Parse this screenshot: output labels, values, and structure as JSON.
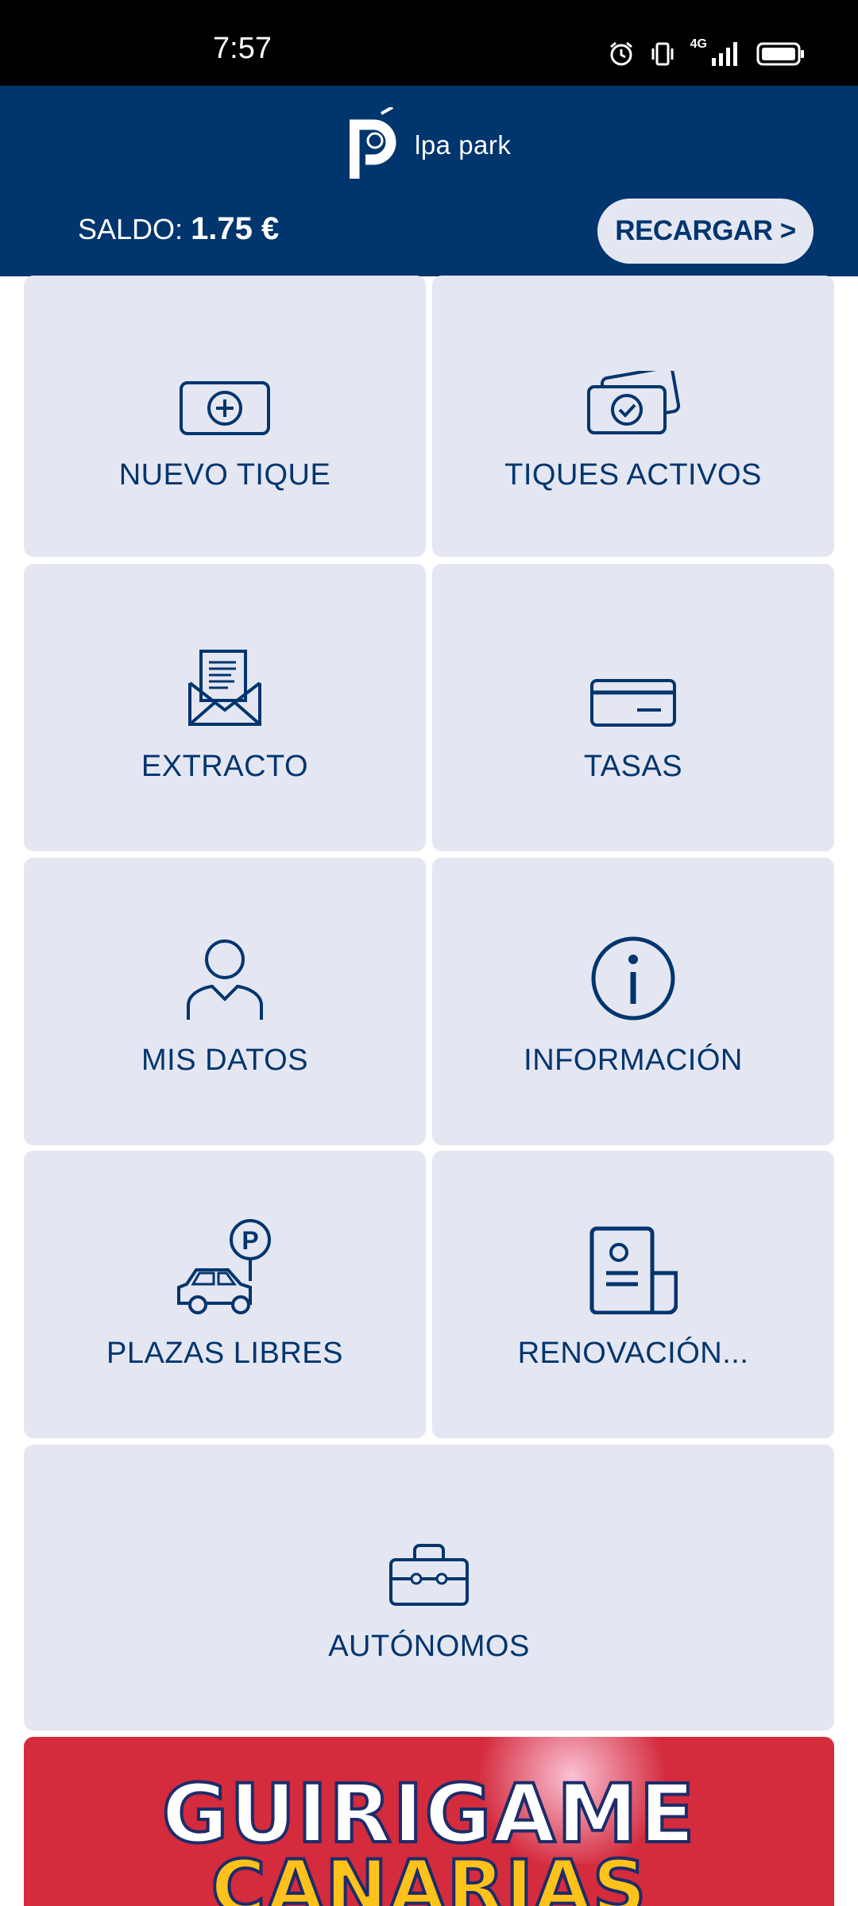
{
  "status_bar": {
    "time": "7:57",
    "network": "4G",
    "icons": [
      "alarm-icon",
      "vibrate-icon",
      "signal-icon",
      "battery-icon"
    ]
  },
  "header": {
    "logo_text": "lpa park",
    "balance_label": "SALDO: ",
    "balance_value": "1.75 €",
    "recharge_label": "RECARGAR >"
  },
  "menu": {
    "new_ticket": "NUEVO TIQUE",
    "active_tickets": "TIQUES ACTIVOS",
    "statement": "EXTRACTO",
    "fees": "TASAS",
    "my_data": "MIS DATOS",
    "information": "INFORMACIÓN",
    "free_spots": "PLAZAS LIBRES",
    "renewal": "RENOVACIÓN...",
    "self_employed": "AUTÓNOMOS"
  },
  "promo": {
    "line1": "GUIRIGAME",
    "line2": "CANARIAS"
  },
  "colors": {
    "brand_navy": "#00356e",
    "tile_bg": "#e4e6f1",
    "promo_red": "#d42b3d",
    "promo_yellow": "#ffc21a"
  }
}
